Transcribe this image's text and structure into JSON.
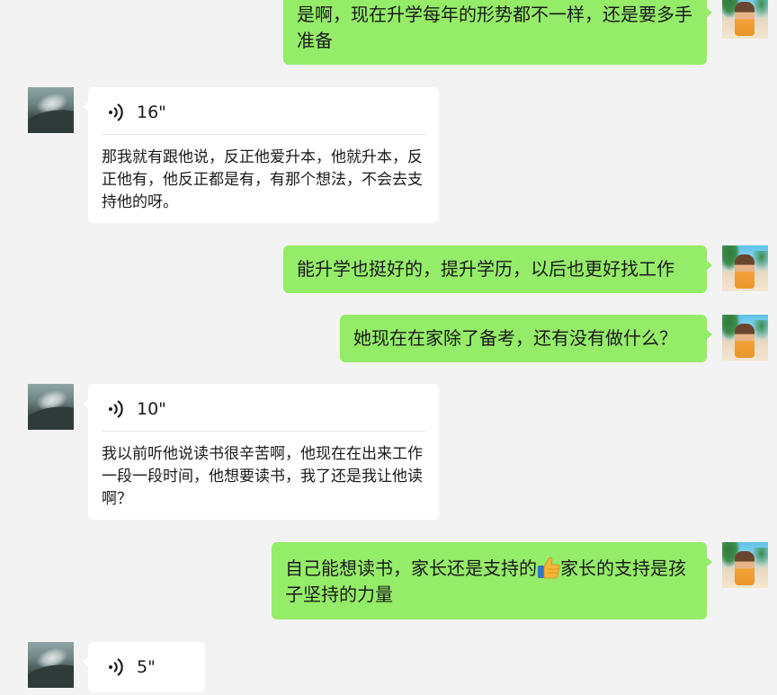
{
  "messages": [
    {
      "side": "me",
      "type": "text",
      "text": "是啊，现在升学每年的形势都不一样，还是要多手准备"
    },
    {
      "side": "other",
      "type": "voice",
      "duration": "16\"",
      "transcript": "那我就有跟他说，反正他爱升本，他就升本，反正他有，他反正都是有，有那个想法，不会去支持他的呀。"
    },
    {
      "side": "me",
      "type": "text",
      "text": "能升学也挺好的，提升学历，以后也更好找工作"
    },
    {
      "side": "me",
      "type": "text",
      "text": "她现在在家除了备考，还有没有做什么？"
    },
    {
      "side": "other",
      "type": "voice",
      "duration": "10\"",
      "transcript": "我以前听他说读书很辛苦啊，他现在在出来工作一段一段时间，他想要读书，我了还是我让他读啊？"
    },
    {
      "side": "me",
      "type": "text",
      "text_before": "自己能想读书，家长还是支持的",
      "emoji": "thumbs-up",
      "text_after": "家长的支持是孩子坚持的力量"
    },
    {
      "side": "other",
      "type": "voice",
      "duration": "5\"",
      "transcript": ""
    }
  ],
  "colors": {
    "background": "#f3f3f3",
    "my_bubble": "#95ec69",
    "other_bubble": "#ffffff"
  }
}
